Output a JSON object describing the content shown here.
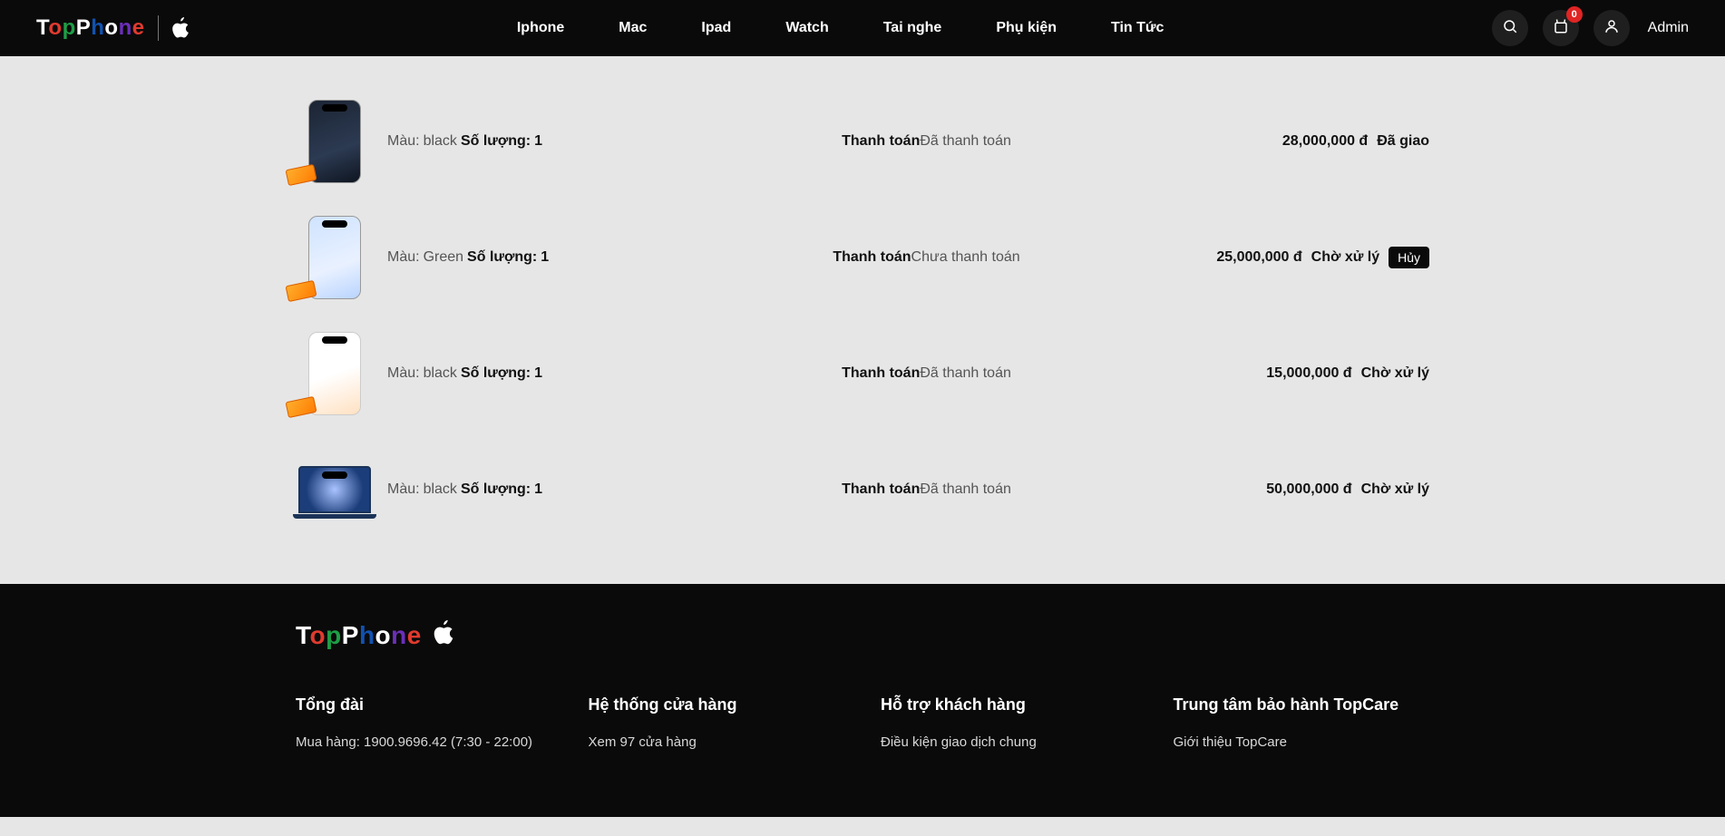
{
  "brand": {
    "letters": [
      "T",
      "o",
      "p",
      "P",
      "h",
      "o",
      "n",
      "e"
    ]
  },
  "nav": [
    "Iphone",
    "Mac",
    "Ipad",
    "Watch",
    "Tai nghe",
    "Phụ kiện",
    "Tin Tức"
  ],
  "cart_badge": "0",
  "user_label": "Admin",
  "labels": {
    "color": "Màu:",
    "qty": "Số lượng:",
    "payment": "Thanh toán",
    "cancel": "Hủy"
  },
  "orders": [
    {
      "thumb": "dark",
      "refund": true,
      "color": "black",
      "qty": "1",
      "pay_status": "Đã thanh toán",
      "price": "28,000,000 đ",
      "status": "Đã giao",
      "cancel": false
    },
    {
      "thumb": "light",
      "refund": true,
      "color": "Green",
      "qty": "1",
      "pay_status": "Chưa thanh toán",
      "price": "25,000,000 đ",
      "status": "Chờ xử lý",
      "cancel": true
    },
    {
      "thumb": "white",
      "refund": true,
      "color": "black",
      "qty": "1",
      "pay_status": "Đã thanh toán",
      "price": "15,000,000 đ",
      "status": "Chờ xử lý",
      "cancel": false
    },
    {
      "thumb": "mac",
      "refund": false,
      "color": "black",
      "qty": "1",
      "pay_status": "Đã thanh toán",
      "price": "50,000,000 đ",
      "status": "Chờ xử lý",
      "cancel": false
    }
  ],
  "footer": {
    "cols": [
      {
        "title": "Tổng đài",
        "links": [
          "Mua hàng: 1900.9696.42 (7:30 - 22:00)"
        ]
      },
      {
        "title": "Hệ thống cửa hàng",
        "links": [
          "Xem 97 cửa hàng"
        ]
      },
      {
        "title": "Hỗ trợ khách hàng",
        "links": [
          "Điều kiện giao dịch chung"
        ]
      },
      {
        "title": "Trung tâm bảo hành TopCare",
        "links": [
          "Giới thiệu TopCare"
        ]
      }
    ]
  }
}
